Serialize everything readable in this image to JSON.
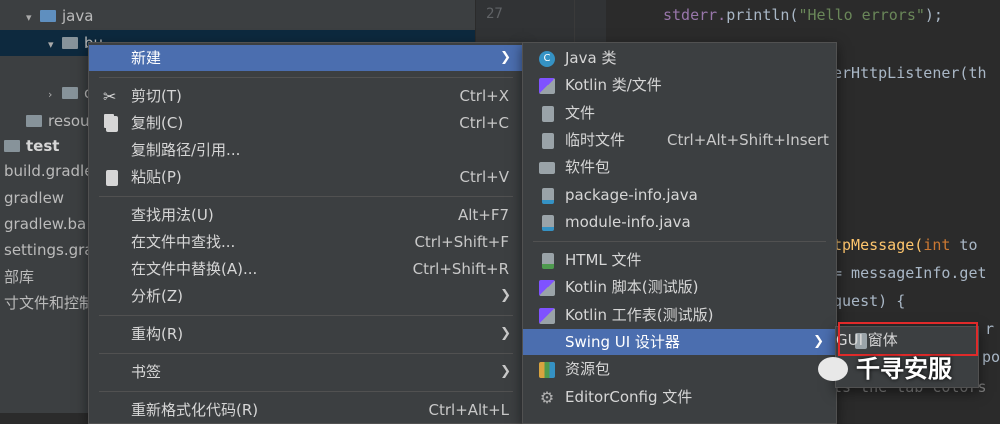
{
  "tree": {
    "rows": [
      {
        "label": "java",
        "indent": 1,
        "arrow": "▾",
        "kind": "folder-blue"
      },
      {
        "label": "bu",
        "indent": 2,
        "arrow": "▾",
        "kind": "folder",
        "selected": true
      },
      {
        "label": "",
        "indent": 4,
        "arrow": "",
        "kind": "class"
      },
      {
        "label": "or",
        "indent": 2,
        "arrow": "›",
        "kind": "folder"
      },
      {
        "label": "resou",
        "indent": 1,
        "arrow": "",
        "kind": "folder"
      },
      {
        "label": "test",
        "indent": 0,
        "arrow": "",
        "kind": "folder"
      },
      {
        "label": "build.gradle",
        "indent": 0,
        "arrow": "",
        "kind": "text"
      },
      {
        "label": "gradlew",
        "indent": 0,
        "arrow": "",
        "kind": "text"
      },
      {
        "label": "gradlew.ba",
        "indent": 0,
        "arrow": "",
        "kind": "text"
      },
      {
        "label": "settings.gra",
        "indent": 0,
        "arrow": "",
        "kind": "text"
      },
      {
        "label": "部库",
        "indent": 0,
        "arrow": "",
        "kind": "text"
      },
      {
        "label": "寸文件和控制",
        "indent": 0,
        "arrow": "",
        "kind": "text"
      }
    ]
  },
  "gutter": {
    "line_number": "27"
  },
  "code": {
    "line1_a": "stderr.",
    "line1_b": "println(",
    "line1_c": "\"Hello errors\"",
    "line1_d": ");",
    "line2": "erHttpListener(th",
    "line3_a": "tpMessage(",
    "line3_b": "int",
    "line3_c": " to",
    "line4": "= messageInfo.get",
    "line5": "quest) {",
    "line6": "r",
    "line7": "po",
    "line8": "ts the tab colors"
  },
  "menu_main": {
    "items": [
      {
        "label": "新建",
        "shortcut": "",
        "submenu": true,
        "icon": "",
        "highlighted": true
      },
      {
        "sep": true
      },
      {
        "label": "剪切(T)",
        "shortcut": "Ctrl+X",
        "icon": "scissors-icon"
      },
      {
        "label": "复制(C)",
        "shortcut": "Ctrl+C",
        "icon": "copy-icon"
      },
      {
        "label": "复制路径/引用...",
        "shortcut": "",
        "icon": ""
      },
      {
        "label": "粘贴(P)",
        "shortcut": "Ctrl+V",
        "icon": "paste-icon"
      },
      {
        "sep": true
      },
      {
        "label": "查找用法(U)",
        "shortcut": "Alt+F7",
        "icon": ""
      },
      {
        "label": "在文件中查找...",
        "shortcut": "Ctrl+Shift+F",
        "icon": ""
      },
      {
        "label": "在文件中替换(A)...",
        "shortcut": "Ctrl+Shift+R",
        "icon": ""
      },
      {
        "label": "分析(Z)",
        "shortcut": "",
        "submenu": true,
        "icon": ""
      },
      {
        "sep": true
      },
      {
        "label": "重构(R)",
        "shortcut": "",
        "submenu": true,
        "icon": ""
      },
      {
        "sep": true
      },
      {
        "label": "书签",
        "shortcut": "",
        "submenu": true,
        "icon": ""
      },
      {
        "sep": true
      },
      {
        "label": "重新格式化代码(R)",
        "shortcut": "Ctrl+Alt+L",
        "icon": ""
      }
    ]
  },
  "menu_new": {
    "items": [
      {
        "label": "Java 类",
        "shortcut": "",
        "icon": "java-class-icon"
      },
      {
        "label": "Kotlin 类/文件",
        "shortcut": "",
        "icon": "kotlin-icon"
      },
      {
        "label": "文件",
        "shortcut": "",
        "icon": "file-icon"
      },
      {
        "label": "临时文件",
        "shortcut": "Ctrl+Alt+Shift+Insert",
        "icon": "scratch-file-icon"
      },
      {
        "label": "软件包",
        "shortcut": "",
        "icon": "package-icon"
      },
      {
        "label": "package-info.java",
        "shortcut": "",
        "icon": "java-file-icon"
      },
      {
        "label": "module-info.java",
        "shortcut": "",
        "icon": "java-file-icon"
      },
      {
        "sep": true
      },
      {
        "label": "HTML 文件",
        "shortcut": "",
        "icon": "html-file-icon"
      },
      {
        "label": "Kotlin 脚本(测试版)",
        "shortcut": "",
        "icon": "kotlin-icon"
      },
      {
        "label": "Kotlin 工作表(测试版)",
        "shortcut": "",
        "icon": "kotlin-icon"
      },
      {
        "label": "Swing UI 设计器",
        "shortcut": "",
        "submenu": true,
        "icon": "",
        "highlighted": true
      },
      {
        "label": "资源包",
        "shortcut": "",
        "icon": "resource-bundle-icon"
      },
      {
        "label": "EditorConfig 文件",
        "shortcut": "",
        "icon": "gear-icon"
      }
    ]
  },
  "menu_swing": {
    "items": [
      {
        "label": "GUI 窗体",
        "icon": "form-file-icon"
      }
    ]
  },
  "watermark": {
    "text": "千寻安服"
  },
  "colors": {
    "menu_bg": "#3c3f41",
    "highlight": "#4b6eaf",
    "editor_bg": "#2b2b2b",
    "box": "#e02a2a"
  }
}
